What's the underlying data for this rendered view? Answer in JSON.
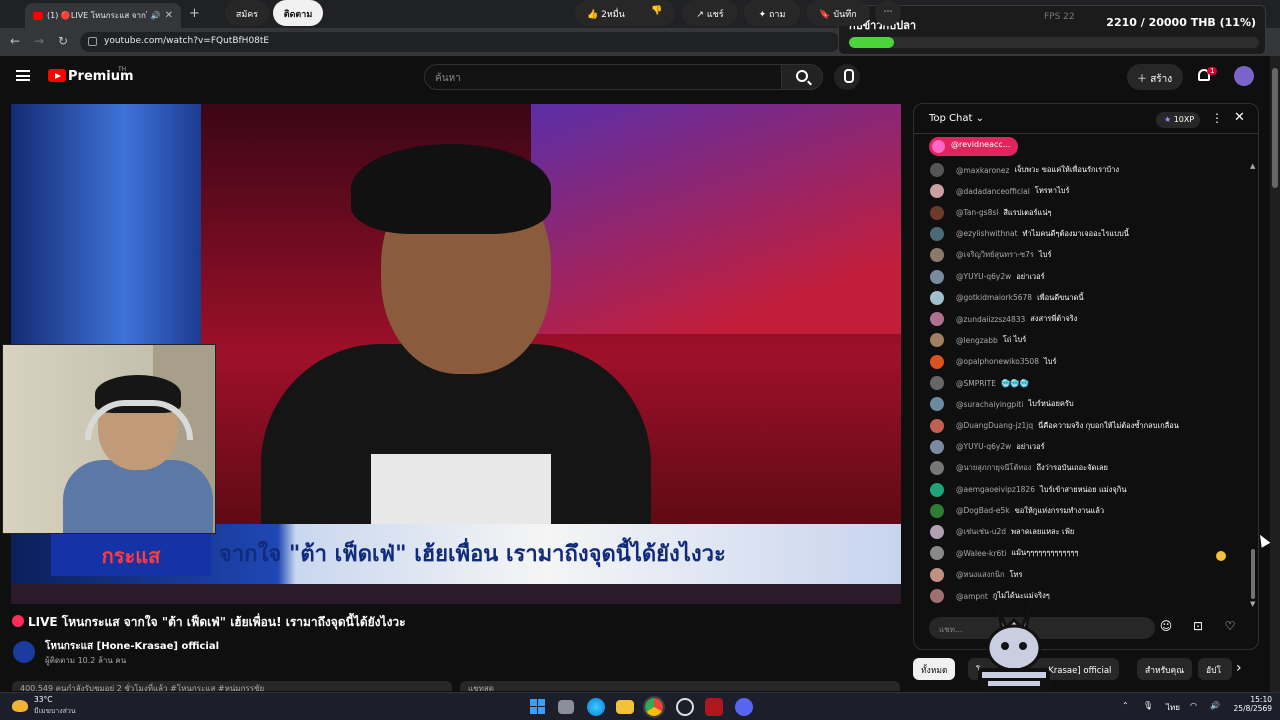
{
  "browser": {
    "tab_title": "(1) 🔴LIVE โหนกระแส จากใจ",
    "url": "youtube.com/watch?v=FQutBfH08tE"
  },
  "donation": {
    "name": "กับข้าวกับปลา",
    "amount_text": "2210 / 20000 THB (11%)",
    "fps_text": "FPS  22",
    "progress": 0.11,
    "color": "#4cd43c"
  },
  "header": {
    "brand": "Premium",
    "brand_sup": "TH",
    "search_placeholder": "ค้นหา",
    "create_label": "สร้าง",
    "notif_count": "1"
  },
  "video": {
    "headline": "จากใจ \"ต้า เฟ็ดเฟ่\" เฮ้ยเพื่อน เรามาถึงจุดนี้ได้ยังไงวะ",
    "tag": "กระแส"
  },
  "meta": {
    "title": "LIVE โหนกระแส จากใจ \"ต้า เฟ็ดเฟ่\" เฮ้ยเพื่อน! เรามาถึงจุดนี้ได้ยังไงวะ",
    "channel": "โหนกระแส [Hone-Krasae] official",
    "subs": "ผู้ติดตาม 10.2 ล้าน คน",
    "join_label": "สมัคร",
    "subscribe_label": "ติดตาม",
    "like_count": "2หมื่น",
    "share_label": "แชร์",
    "ask_label": "ถาม",
    "save_label": "บันทึก",
    "desc_text": "400,549 คนกำลังรับชมอยู่ 2 ชั่วโมงที่แล้ว #โหนกระแส #หนุ่มกรรชัย",
    "desc2_text": "แชทสด"
  },
  "chat": {
    "title": "Top Chat",
    "xp": "10XP",
    "pinned": "@revidneacc...",
    "input_placeholder": "แชท...",
    "messages": [
      {
        "author": "@maxkaronez",
        "text": "เจ็บพวะ ขอแค่ให้เพื่อนรักเราบ้าง",
        "color": "#555"
      },
      {
        "author": "@dadadanceofficial",
        "text": "โทรหาไบร์",
        "color": "#c8a0a0"
      },
      {
        "author": "@Tan-gs8sl",
        "text": "สีแรปเตอร์แน่ๆ",
        "color": "#6d3b2c"
      },
      {
        "author": "@ezylishwithnat",
        "text": "ทำไมคนดีๆต้องมาเจออะไรแบบนี้",
        "color": "#4a6a7a"
      },
      {
        "author": "@เจริญวิทย์สุนทรา-ซ7ร",
        "text": "ไบร์",
        "color": "#8a7a6a"
      },
      {
        "author": "@YUYU-q6y2w",
        "text": "อย่าเวอร์",
        "color": "#7a8aa0"
      },
      {
        "author": "@gotkidmaiork5678",
        "text": "เพื่อนดีขนาดนี้",
        "color": "#a0c0d0"
      },
      {
        "author": "@zundaiizzsz4833",
        "text": "สงสารพี่ต้าจริง",
        "color": "#b07090"
      },
      {
        "author": "@lengzabb",
        "text": "โถ่ ไบร์",
        "color": "#a08060"
      },
      {
        "author": "@opalphonewiko3508",
        "text": "ไบร์",
        "color": "#d9531e"
      },
      {
        "author": "@SMPRITE",
        "text": "🥶🥶🥶",
        "color": "#666"
      },
      {
        "author": "@surachaiyingpiti",
        "text": "ไบร์หน่อยครับ",
        "color": "#6a8aa0"
      },
      {
        "author": "@DuangDuang-jz1jq",
        "text": "นี่คือความจริง กุบอกให้ไม่ต้องซ้ำกลบเกลื่อน",
        "color": "#c06050"
      },
      {
        "author": "@YUYU-q6y2w",
        "text": "อย่าเวอร์",
        "color": "#7a8aa0"
      },
      {
        "author": "@นายสุภกายุจนีโต้ทอง",
        "text": "ถึงว่ารอบันเถอะจัดเลย",
        "color": "#777"
      },
      {
        "author": "@aemgaoeivipz1826",
        "text": "ไบร์เข้าสายหน่อย แม่งจุกิน",
        "color": "#1fa37a"
      },
      {
        "author": "@DogBad-e5k",
        "text": "ขอให้กูแห่งกรรมทำงานแล้ว",
        "color": "#2e7d32"
      },
      {
        "author": "@เช่นเช่น-u2d",
        "text": "พลาดเลยแหละ เฟ้ย",
        "color": "#b0a0b0"
      },
      {
        "author": "@Walee-kr6ti",
        "text": "แม้นๆๆๆๆๆๆๆๆๆๆๆๆๆ",
        "color": "#888"
      },
      {
        "author": "@หนงแสงกนิก",
        "text": "โทร",
        "color": "#c09080"
      },
      {
        "author": "@ampnt",
        "text": "กูไม่ได้นะแม่จริงๆ",
        "color": "#a07070"
      }
    ]
  },
  "chips": [
    "ทั้งหมด",
    "โหนกระแส [Hone-Krasae] official",
    "สำหรับคุณ",
    "อัปโ"
  ],
  "taskbar": {
    "temp": "33°C",
    "weather": "มีเมฆบางส่วน",
    "lang": "ไทย",
    "time": "15:10",
    "date": "25/8/2569"
  }
}
